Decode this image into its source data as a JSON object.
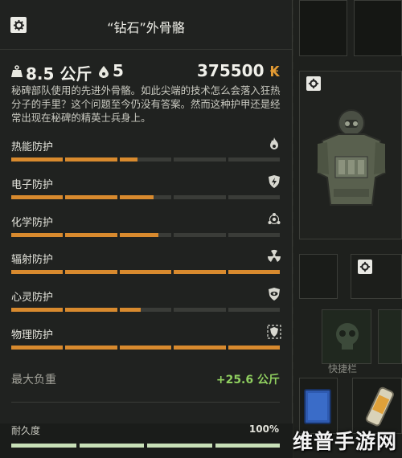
{
  "tooltip": {
    "title": "“钻石”外骨骼",
    "weight": "8.5 公斤",
    "slots": "5",
    "price": "375500",
    "price_currency": "₭",
    "description": "秘碑部队使用的先进外骨骼。如此尖端的技术怎么会落入狂热分子的手里？这个问题至今仍没有答案。然而这种护甲还是经常出现在秘碑的精英士兵身上。",
    "protections": [
      {
        "label": "热能防护",
        "icon": "fire-icon",
        "level": 0.47
      },
      {
        "label": "电子防护",
        "icon": "lightning-shield-icon",
        "level": 0.53
      },
      {
        "label": "化学防护",
        "icon": "biohazard-icon",
        "level": 0.55
      },
      {
        "label": "辐射防护",
        "icon": "radiation-icon",
        "level": 1.0
      },
      {
        "label": "心灵防护",
        "icon": "psy-eye-shield-icon",
        "level": 0.48
      },
      {
        "label": "物理防护",
        "icon": "armor-shield-icon",
        "level": 1.0
      }
    ],
    "capacity_label": "最大负重",
    "capacity_value": "+25.6 公斤",
    "durability_label": "耐久度",
    "durability_value": "100%",
    "durability_level": 1.0
  },
  "inventory": {
    "quickbar_label": "快捷栏"
  },
  "watermark": "维普手游网",
  "colors": {
    "bar_fill": "#d88a2e",
    "bar_empty": "#3a3c38",
    "capacity_green": "#8fcf5f",
    "currency_orange": "#e29a33",
    "durability_fill": "#c8e0b8"
  }
}
